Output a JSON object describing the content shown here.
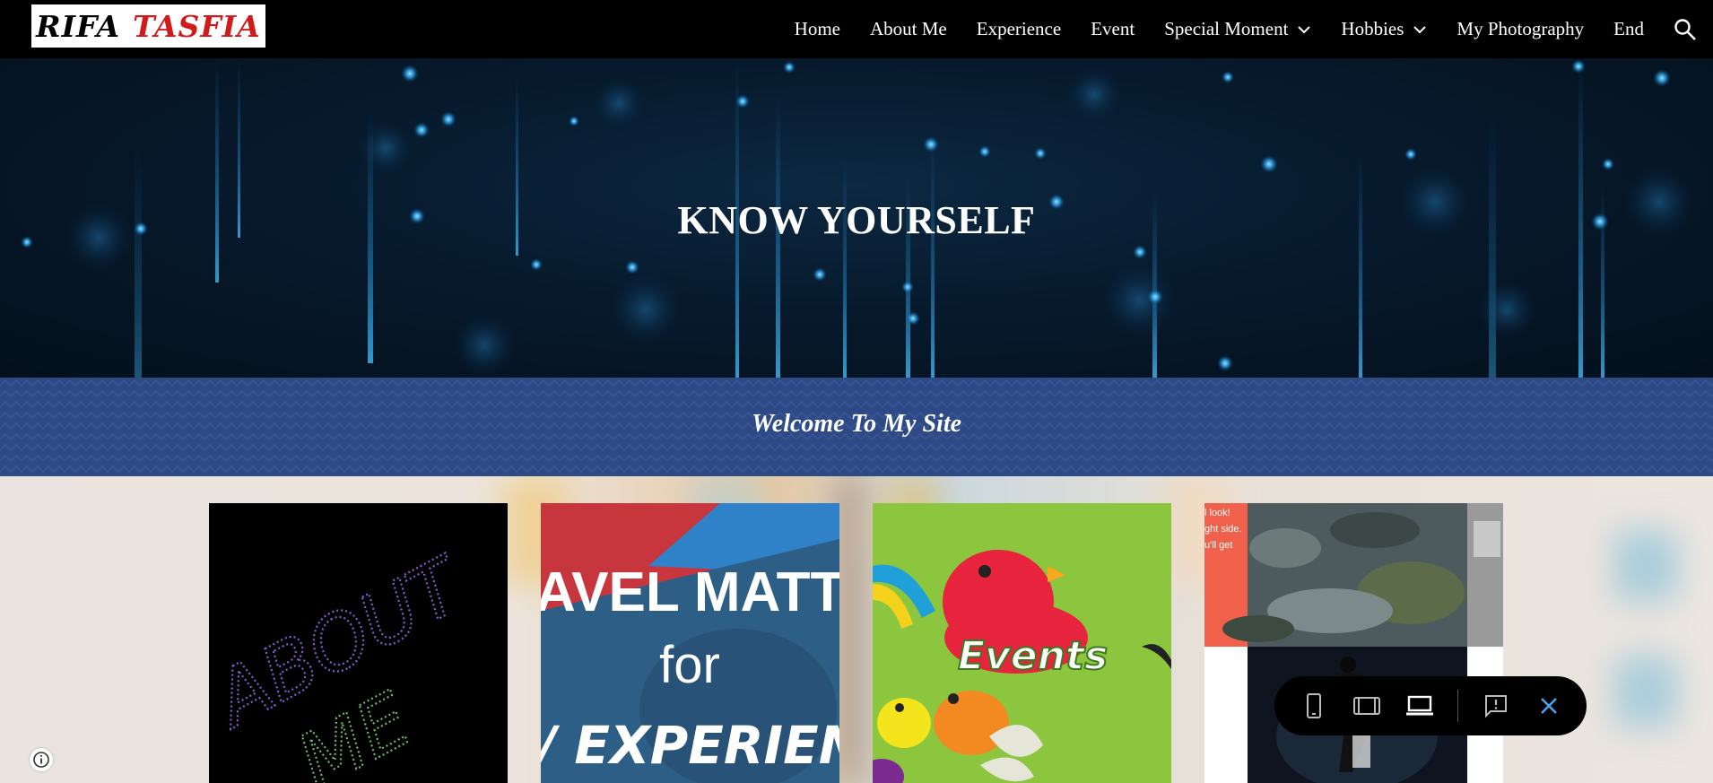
{
  "logo": {
    "word1": "RIFA",
    "word2": "TASFIA"
  },
  "nav": {
    "items": [
      {
        "label": "Home",
        "dropdown": false
      },
      {
        "label": "About Me",
        "dropdown": false
      },
      {
        "label": "Experience",
        "dropdown": false
      },
      {
        "label": "Event",
        "dropdown": false
      },
      {
        "label": "Special Moment",
        "dropdown": true
      },
      {
        "label": "Hobbies",
        "dropdown": true
      },
      {
        "label": "My Photography",
        "dropdown": false
      },
      {
        "label": "End",
        "dropdown": false
      }
    ],
    "search_icon": "search-icon"
  },
  "hero": {
    "title": "KNOW YOURSELF"
  },
  "band": {
    "title": "Welcome To My Site"
  },
  "cards": {
    "about": {
      "text1": "ABOUT",
      "text2": "ME"
    },
    "travel": {
      "line1": "AVEL MATTE",
      "line2": "for",
      "line3": "/ EXPERIEN"
    },
    "events": {
      "label": "Events"
    },
    "photo": {
      "snippet1": "l look!",
      "snippet2": "ght side.",
      "snippet3": "u'll get"
    }
  },
  "toolbar": {
    "icons": [
      "phone-icon",
      "tablet-icon",
      "laptop-icon",
      "feedback-icon",
      "close-icon"
    ],
    "accent": "#4aa3f0"
  },
  "colors": {
    "topbar": "#000000",
    "band": "#2d4a86",
    "logo_red": "#d11a1a"
  }
}
